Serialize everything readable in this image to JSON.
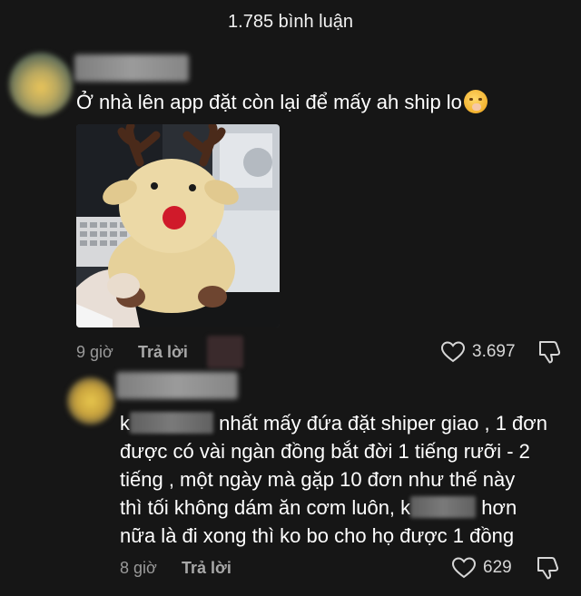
{
  "header": {
    "title": "1.785 bình luận"
  },
  "comment1": {
    "text": "Ở nhà lên app đặt còn lại để mấy ah ship lo",
    "emoji": "hand-over-mouth-emoji",
    "time": "9 giờ",
    "reply_label": "Trả lời",
    "likes": "3.697"
  },
  "comment2": {
    "line1_end": "nhất mấy đứa đặt shiper giao , 1 đơn",
    "line1_start": "k",
    "line2": "được có vài ngàn đồng bắt đời 1 tiếng rưỡi - 2",
    "line3": "tiếng , một ngày mà gặp 10 đơn như thế này",
    "line4_start": "thì tối không dám ăn cơm luôn, ",
    "line4_mid": "k",
    "line4_end": "hơn",
    "line5": "nữa là đi xong thì ko bo cho họ được 1 đồng",
    "time": "8 giờ",
    "reply_label": "Trả lời",
    "likes": "629"
  },
  "colors": {
    "background": "#161616",
    "text": "#ffffff",
    "muted": "#9a9a9a"
  }
}
